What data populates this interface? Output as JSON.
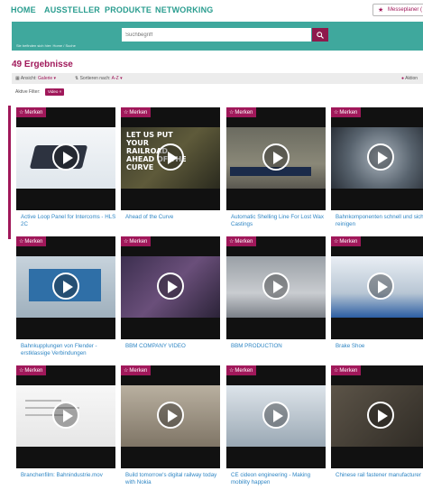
{
  "nav": {
    "items": [
      "HOME",
      "AUSSTELLER",
      "PRODUKTE",
      "NETWORKING"
    ],
    "planer_label": "Messeplaner ("
  },
  "search": {
    "placeholder": "Suchbegriff",
    "breadcrumb": "Sie befinden sich hier: Home / Suche"
  },
  "results": {
    "count_label": "49 Ergebnisse",
    "view_label": "Ansicht:",
    "view_value": "Galerie",
    "sort_label": "Sortieren nach:",
    "sort_value": "A-Z",
    "right_action": "Aktion",
    "active_filter_label": "Aktive Filter:",
    "active_filter_chip": "Video ×"
  },
  "colors": {
    "accent": "#a0185a",
    "teal": "#3fa89d",
    "link": "#2f86c4"
  },
  "cards": [
    {
      "merken": "Merken",
      "title": "Active Loop Panel for Intercoms - HLS 2C"
    },
    {
      "merken": "Merken",
      "title": "Ahead of the Curve",
      "overlay": "LET US PUT YOUR RAILROAD AHEAD OF THE CURVE"
    },
    {
      "merken": "Merken",
      "title": "Automatic Shelling Line For Lost Wax Castings"
    },
    {
      "merken": "Merken",
      "title": "Bahnkomponenten schnell und sicher reinigen"
    },
    {
      "merken": "Merken",
      "title": "Bahnkupplungen von Flender - erstklassige Verbindungen"
    },
    {
      "merken": "Merken",
      "title": "BBM COMPANY VIDEO"
    },
    {
      "merken": "Merken",
      "title": "BBM PRODUCTION"
    },
    {
      "merken": "Merken",
      "title": "Brake Shoe"
    },
    {
      "merken": "Merken",
      "title": "Branchenfilm: Bahnindustrie.mov"
    },
    {
      "merken": "Merken",
      "title": "Build tomorrow's digital railway today with Nokia"
    },
    {
      "merken": "Merken",
      "title": "CE cideon engineering - Making mobility happen"
    },
    {
      "merken": "Merken",
      "title": "Chinese rail fastener manufacturer"
    }
  ]
}
